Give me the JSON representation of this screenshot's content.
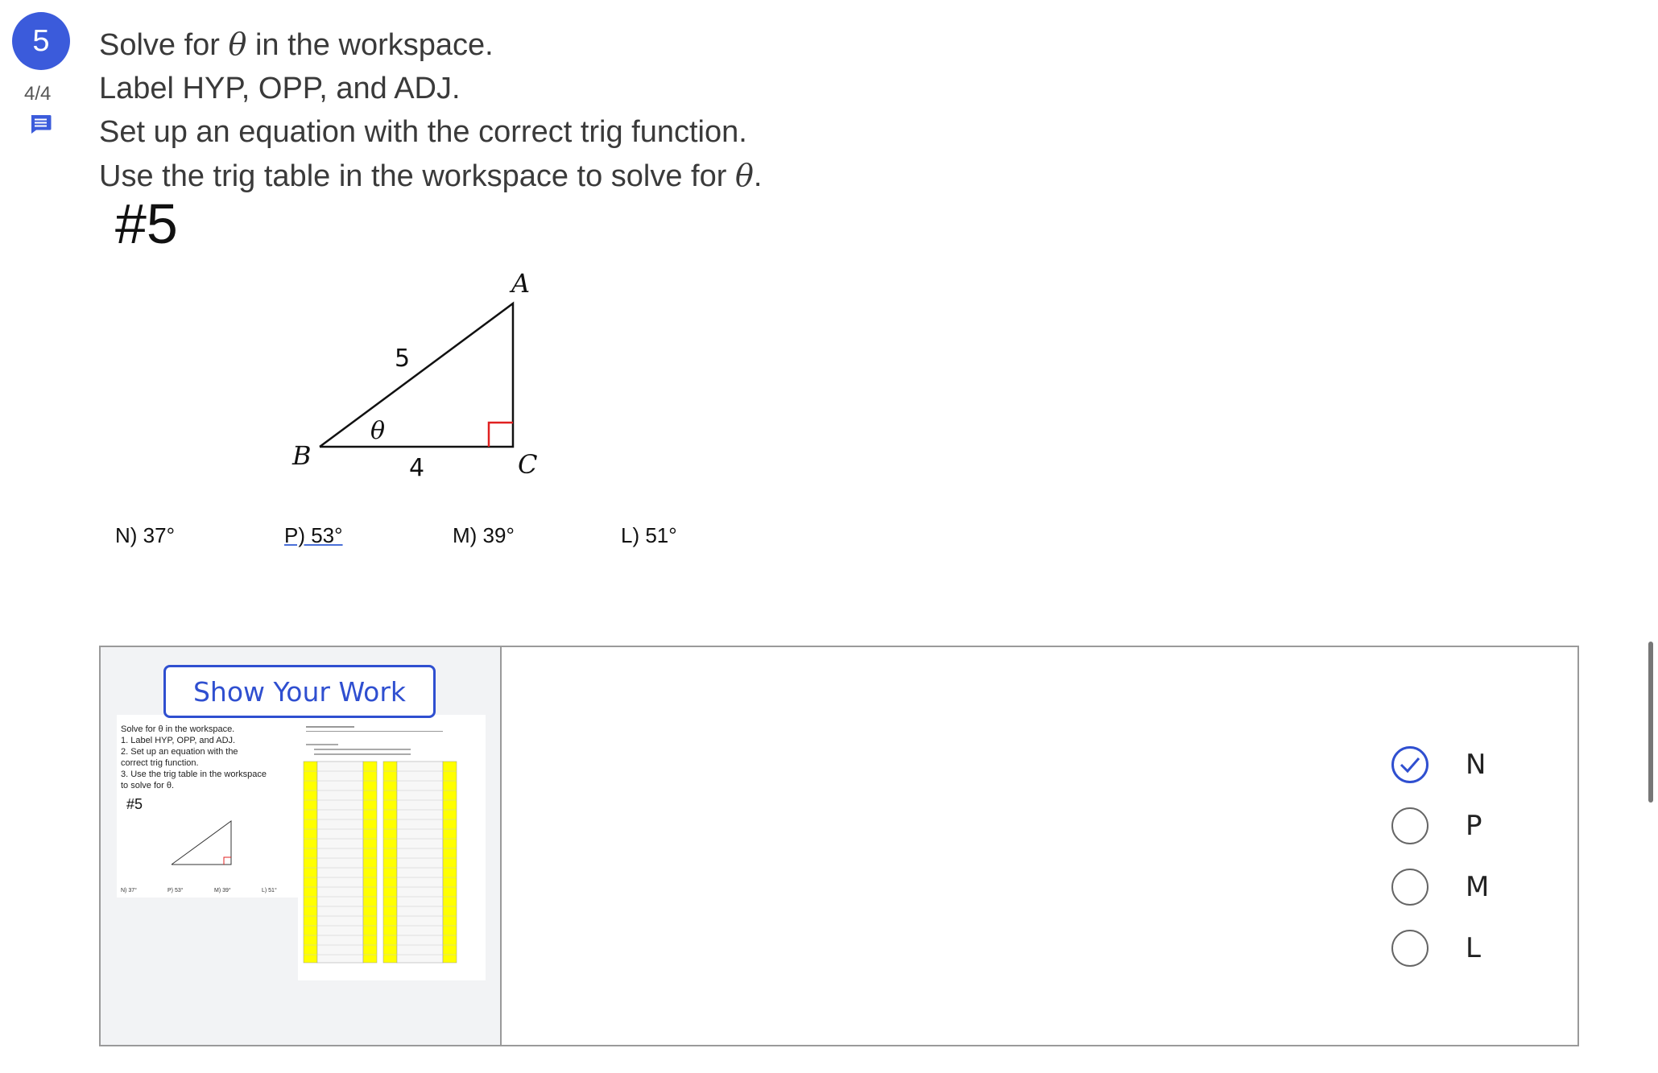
{
  "question": {
    "number": "5",
    "score": "4/4"
  },
  "instructions": {
    "line1_a": "Solve for ",
    "line1_b": " in the workspace.",
    "line2": "Label HYP, OPP, and ADJ.",
    "line3": "Set up an equation with the correct trig function.",
    "line4_a": "Use the trig table in the workspace to solve for ",
    "line4_b": ".",
    "theta": "θ"
  },
  "problem": {
    "label": "#5",
    "triangle": {
      "vertex_a": "A",
      "vertex_b": "B",
      "vertex_c": "C",
      "hyp_length": "5",
      "adj_length": "4",
      "angle": "θ"
    }
  },
  "choices": [
    {
      "text": "N) 37°"
    },
    {
      "text": "P)  53°"
    },
    {
      "text": "M)  39°"
    },
    {
      "text": "L)  51°"
    }
  ],
  "workspace": {
    "show_work_label": "Show Your Work",
    "thumbnail": {
      "instr_lines": [
        "Solve for θ in the workspace.",
        "1. Label HYP, OPP, and ADJ.",
        "2. Set up an equation with the",
        "correct trig function.",
        "3. Use the trig table in the workspace",
        "to solve for θ."
      ],
      "label": "#5",
      "choices": [
        "N) 37°",
        "P) 53°",
        "M) 39°",
        "L) 51°"
      ]
    }
  },
  "answer_options": [
    {
      "label": "N",
      "checked": true
    },
    {
      "label": "P",
      "checked": false
    },
    {
      "label": "M",
      "checked": false
    },
    {
      "label": "L",
      "checked": false
    }
  ],
  "colors": {
    "accent": "#2f4fd0",
    "badge": "#3b5bdb",
    "table_highlight": "#ffff00",
    "right_angle_mark": "#e02020"
  }
}
